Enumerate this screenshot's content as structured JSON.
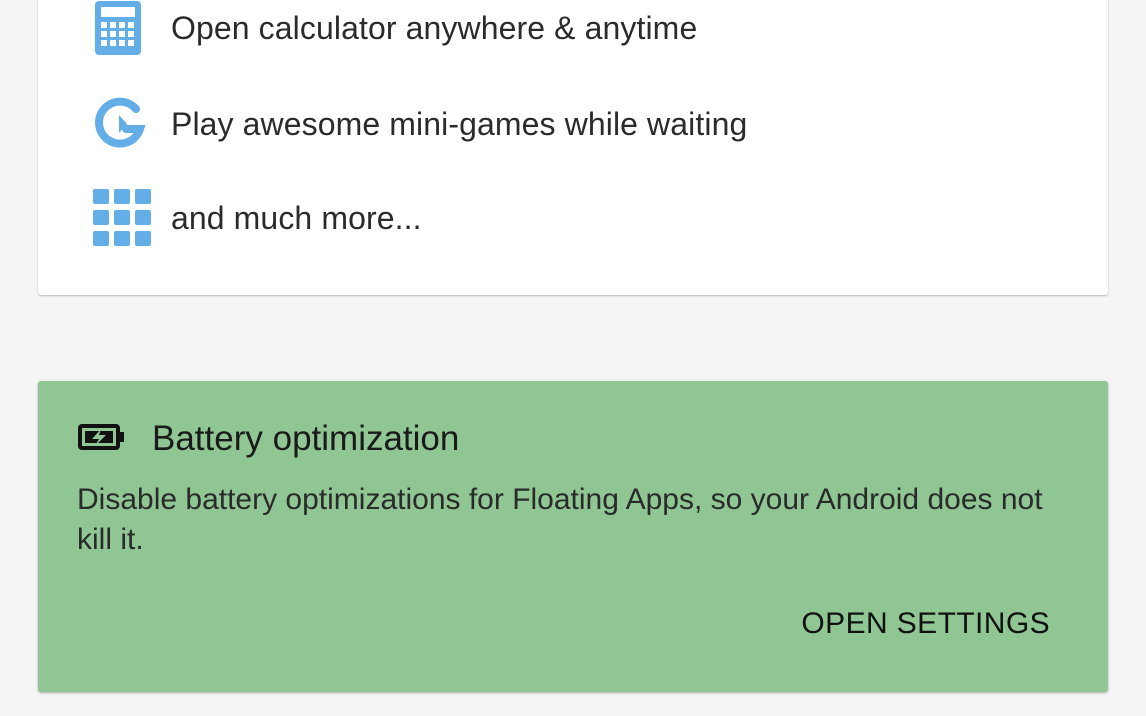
{
  "features": {
    "items": [
      {
        "icon": "calculator-icon",
        "label": "Open calculator anywhere & anytime"
      },
      {
        "icon": "games-icon",
        "label": "Play awesome mini-games while waiting"
      },
      {
        "icon": "apps-grid-icon",
        "label": "and much more..."
      }
    ]
  },
  "battery": {
    "icon": "battery-charging-icon",
    "title": "Battery optimization",
    "description": "Disable battery optimizations for Floating Apps, so your Android does not kill it.",
    "action_label": "OPEN SETTINGS"
  },
  "colors": {
    "icon_blue": "#64aee8",
    "battery_card_bg": "#8fc693",
    "page_bg": "#f5f5f5"
  }
}
